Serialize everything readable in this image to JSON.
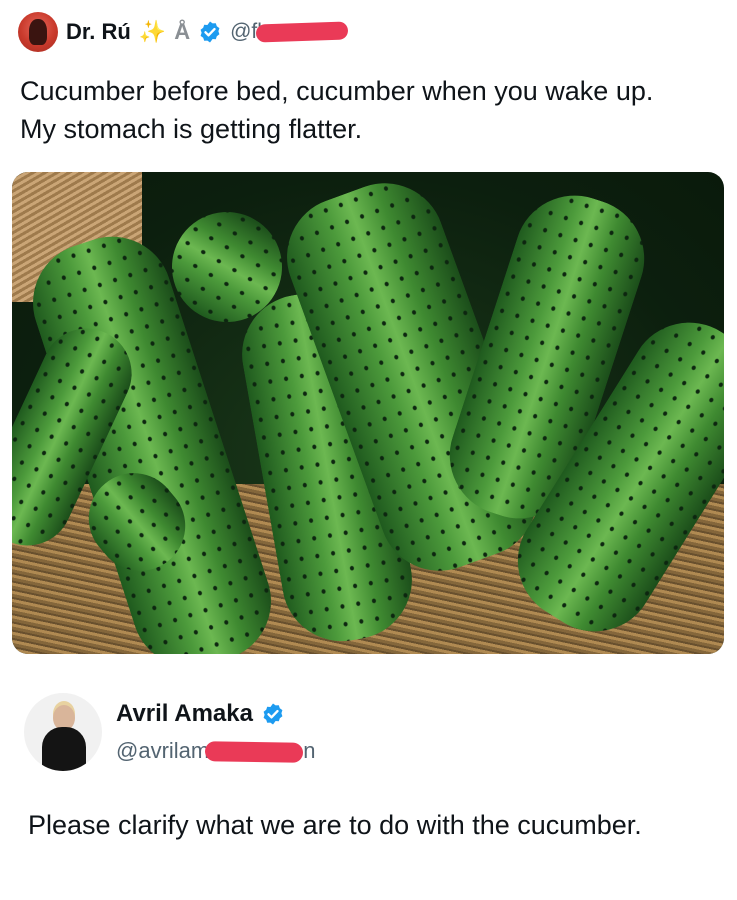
{
  "tweet": {
    "author_name": "Dr. Rú",
    "emojis": [
      "✨",
      "💍"
    ],
    "handle_visible": "@fl",
    "text_line1": "Cucumber before bed, cucumber when you wake up.",
    "text_line2": "My stomach is getting flatter."
  },
  "quote": {
    "author_name": "Avril Amaka",
    "handle_visible": "@avrilam",
    "handle_tail": "n",
    "text": "Please clarify what we are to do with the cucumber."
  },
  "colors": {
    "verified": "#1d9bf0",
    "redaction": "#ea3a57",
    "secondary_text": "#536471"
  },
  "icons": [
    "avatar",
    "sparkles-emoji",
    "ring-emoji",
    "verified-badge-icon"
  ]
}
